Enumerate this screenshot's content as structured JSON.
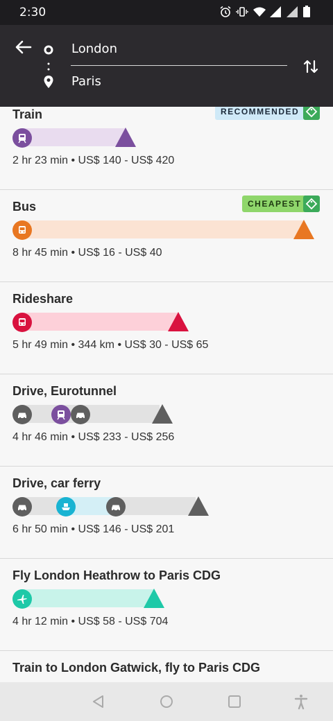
{
  "status": {
    "time": "2:30"
  },
  "search": {
    "from": "London",
    "to": "Paris"
  },
  "routes": [
    {
      "title": "Train",
      "info": "2 hr 23 min • US$ 140 - US$ 420",
      "badge": "RECOMMENDED"
    },
    {
      "title": "Bus",
      "info": "8 hr 45 min • US$ 16 - US$ 40",
      "badge": "CHEAPEST"
    },
    {
      "title": "Rideshare",
      "info": "5 hr 49 min • 344 km • US$ 30 - US$ 65"
    },
    {
      "title": "Drive, Eurotunnel",
      "info": "4 hr 46 min • US$ 233 - US$ 256"
    },
    {
      "title": "Drive, car ferry",
      "info": "6 hr 50 min • US$ 146 - US$ 201"
    },
    {
      "title": "Fly London Heathrow to Paris CDG",
      "info": "4 hr 12 min • US$ 58 - US$ 704"
    },
    {
      "title": "Train to London Gatwick, fly to Paris CDG"
    }
  ],
  "colors": {
    "train": "#7b4f9e",
    "train_bar": "#e9dcef",
    "bus": "#e87722",
    "bus_bar": "#fbe3d3",
    "rideshare": "#d9123f",
    "rideshare_bar": "#fdd0d9",
    "drive": "#5f5f5f",
    "drive_bar": "#e2e2e2",
    "ferry": "#19b3d2",
    "ferry_bar": "#d4eff6",
    "fly": "#1ec9a8",
    "fly_bar": "#c8f3ea",
    "recommended_bg": "#cfe9f7",
    "cheapest_bg": "#8fd66b"
  }
}
